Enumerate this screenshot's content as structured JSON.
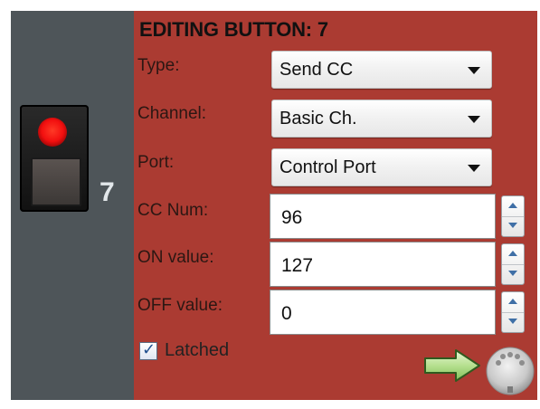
{
  "left_panel": {
    "button_number": "7"
  },
  "editor": {
    "title": "EDITING BUTTON: 7",
    "fields": {
      "type": {
        "label": "Type:",
        "value": "Send CC"
      },
      "channel": {
        "label": "Channel:",
        "value": "Basic Ch."
      },
      "port": {
        "label": "Port:",
        "value": "Control Port"
      },
      "cc_num": {
        "label": "CC Num:",
        "value": "96"
      },
      "on_value": {
        "label": "ON value:",
        "value": "127"
      },
      "off_value": {
        "label": "OFF value:",
        "value": "0"
      }
    },
    "latched": {
      "label": "Latched",
      "checked": true
    }
  },
  "icons": {
    "led": "led-red-icon",
    "arrow": "arrow-right-icon",
    "midi": "midi-connector-icon"
  },
  "colors": {
    "editor_bg": "#ab3b32",
    "side_bg": "#4e5559",
    "led": "#f20f0f"
  }
}
